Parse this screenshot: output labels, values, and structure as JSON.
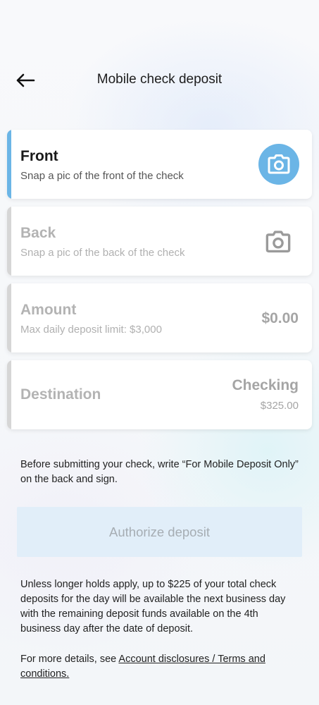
{
  "header": {
    "title": "Mobile check deposit",
    "back_icon": "arrow-left-icon"
  },
  "cards": {
    "front": {
      "title": "Front",
      "subtitle": "Snap a pic of the front of the check",
      "icon": "camera-icon",
      "accent_color": "#6bb5e6"
    },
    "back": {
      "title": "Back",
      "subtitle": "Snap a pic of the back of the check",
      "icon": "camera-icon"
    },
    "amount": {
      "title": "Amount",
      "subtitle": "Max daily deposit limit: $3,000",
      "value": "$0.00"
    },
    "destination": {
      "title": "Destination",
      "account": "Checking",
      "balance": "$325.00"
    }
  },
  "instructions": "Before submitting your check, write “For Mobile Deposit Only” on the back and sign.",
  "authorize_button": "Authorize deposit",
  "holds_notice": "Unless longer holds apply, up to $225 of your total check deposits for the day will be available the next business day with the remaining deposit funds available on the 4th business day after the date of deposit.",
  "details": {
    "prefix": "For more details, see ",
    "link": "Account disclosures / Terms and conditions."
  }
}
